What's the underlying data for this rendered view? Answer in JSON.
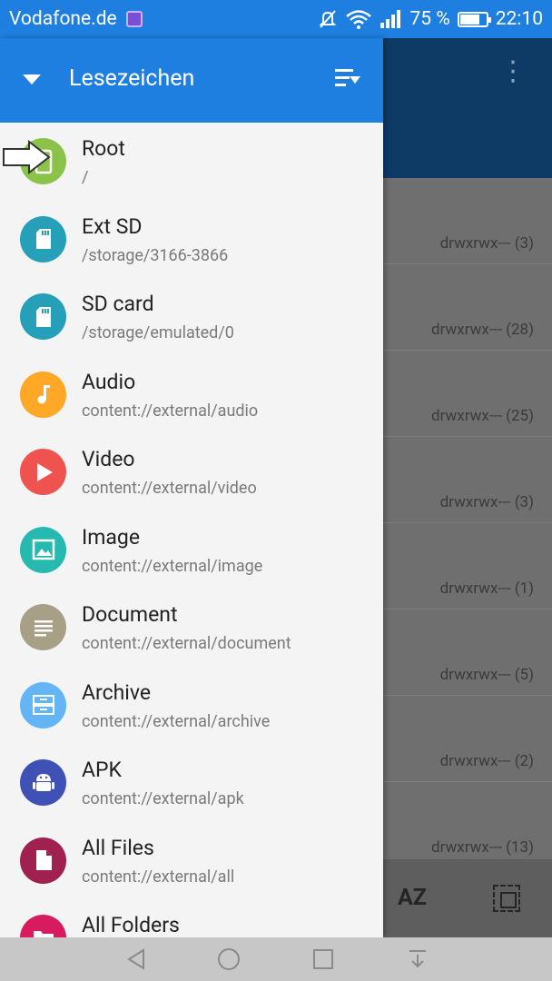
{
  "status_bar": {
    "carrier": "Vodafone.de",
    "battery": "75 %",
    "time": "22:10",
    "battery_level": 0.75
  },
  "drawer": {
    "title": "Lesezeichen",
    "items": [
      {
        "name": "Root",
        "path": "/",
        "color": "#8bc34a",
        "icon": "phone-icon"
      },
      {
        "name": "Ext SD",
        "path": "/storage/3166-3866",
        "color": "#26a0b8",
        "icon": "sd-card-icon"
      },
      {
        "name": "SD card",
        "path": "/storage/emulated/0",
        "color": "#26a0b8",
        "icon": "sd-card-icon"
      },
      {
        "name": "Audio",
        "path": "content://external/audio",
        "color": "#ffa726",
        "icon": "music-note-icon"
      },
      {
        "name": "Video",
        "path": "content://external/video",
        "color": "#ef5350",
        "icon": "play-icon"
      },
      {
        "name": "Image",
        "path": "content://external/image",
        "color": "#26b9b0",
        "icon": "image-icon"
      },
      {
        "name": "Document",
        "path": "content://external/document",
        "color": "#a89f87",
        "icon": "document-icon"
      },
      {
        "name": "Archive",
        "path": "content://external/archive",
        "color": "#64b5f6",
        "icon": "archive-icon"
      },
      {
        "name": "APK",
        "path": "content://external/apk",
        "color": "#3f51b5",
        "icon": "android-icon"
      },
      {
        "name": "All Files",
        "path": "content://external/all",
        "color": "#a0204f",
        "icon": "file-icon"
      },
      {
        "name": "All Folders",
        "path": "",
        "color": "#d81b60",
        "icon": "folder-icon"
      }
    ]
  },
  "background": {
    "rows": [
      {
        "perm": "drwxrwx--- (3)"
      },
      {
        "perm": "drwxrwx--- (28)"
      },
      {
        "perm": "drwxrwx--- (25)"
      },
      {
        "perm": "drwxrwx--- (3)"
      },
      {
        "perm": "drwxrwx--- (1)"
      },
      {
        "perm": "drwxrwx--- (5)"
      },
      {
        "perm": "drwxrwx--- (2)"
      },
      {
        "perm": "drwxrwx--- (13)"
      }
    ],
    "sort_label": "AZ"
  }
}
